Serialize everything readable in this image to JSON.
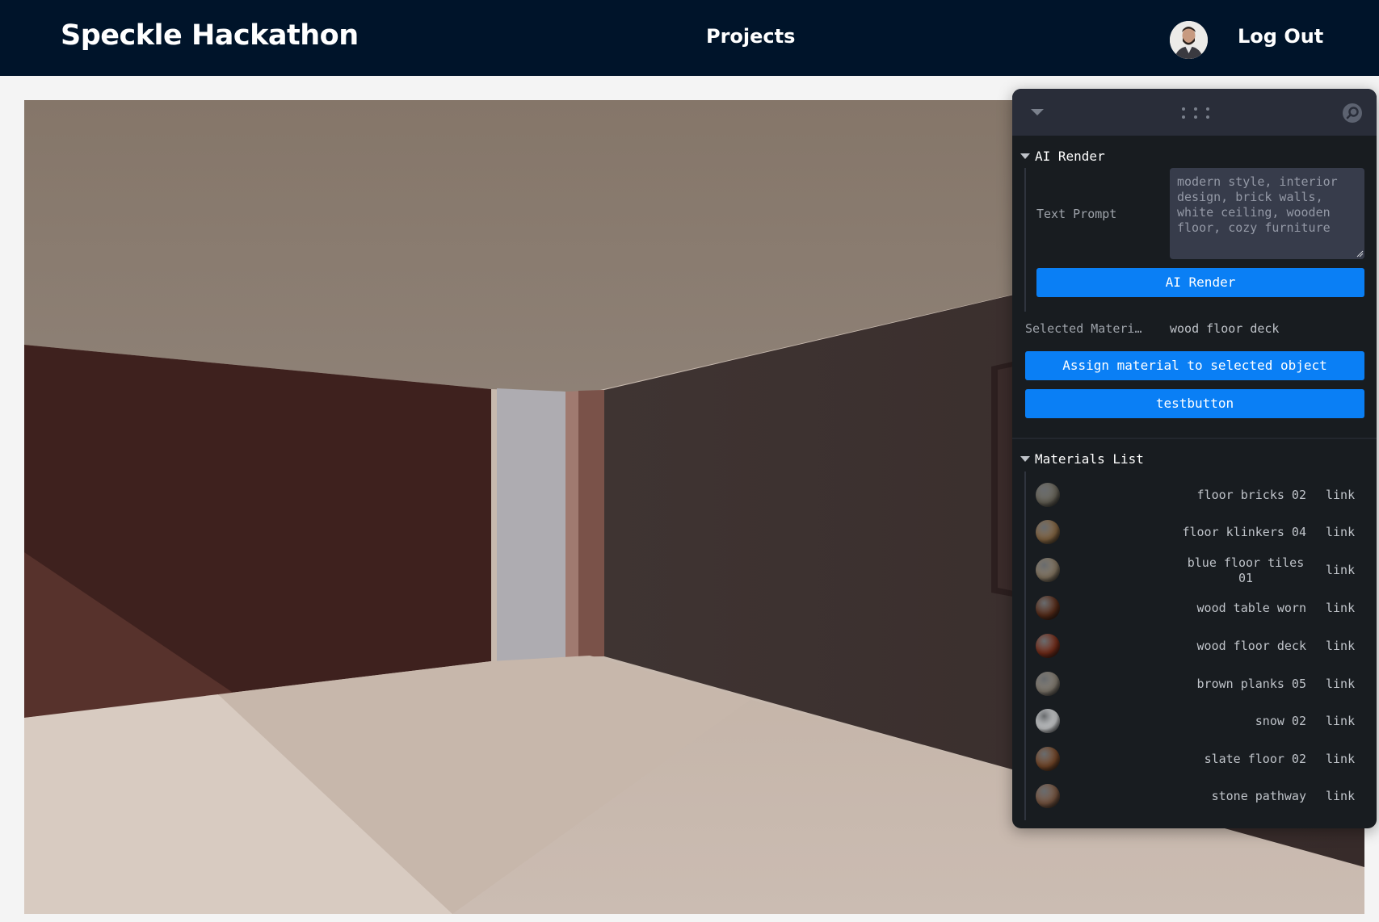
{
  "header": {
    "title": "Speckle Hackathon",
    "nav_projects": "Projects",
    "logout": "Log Out"
  },
  "panel": {
    "ai_render": {
      "title": "AI Render",
      "text_prompt_label": "Text Prompt",
      "text_prompt_value": "modern style, interior design, brick walls, white ceiling, wooden floor, cozy furniture",
      "button_label": "AI Render"
    },
    "selected_material": {
      "label": "Selected Materi…",
      "value": "wood floor deck"
    },
    "assign_button": "Assign material to selected object",
    "test_button": "testbutton",
    "materials_list": {
      "title": "Materials List",
      "items": [
        {
          "name": "floor bricks 02",
          "link": "link",
          "color": "#6e6a5e"
        },
        {
          "name": "floor klinkers 04",
          "link": "link",
          "color": "#8a6a45"
        },
        {
          "name": "blue floor tiles 01",
          "link": "link",
          "color": "#8c7d67"
        },
        {
          "name": "wood table worn",
          "link": "link",
          "color": "#5c2e1a"
        },
        {
          "name": "wood floor deck",
          "link": "link",
          "color": "#7a2e1a"
        },
        {
          "name": "brown planks 05",
          "link": "link",
          "color": "#8a8276"
        },
        {
          "name": "snow 02",
          "link": "link",
          "color": "#d8dadc"
        },
        {
          "name": "slate floor 02",
          "link": "link",
          "color": "#7a4a2a"
        },
        {
          "name": "stone pathway",
          "link": "link",
          "color": "#7e5a44"
        }
      ]
    }
  }
}
